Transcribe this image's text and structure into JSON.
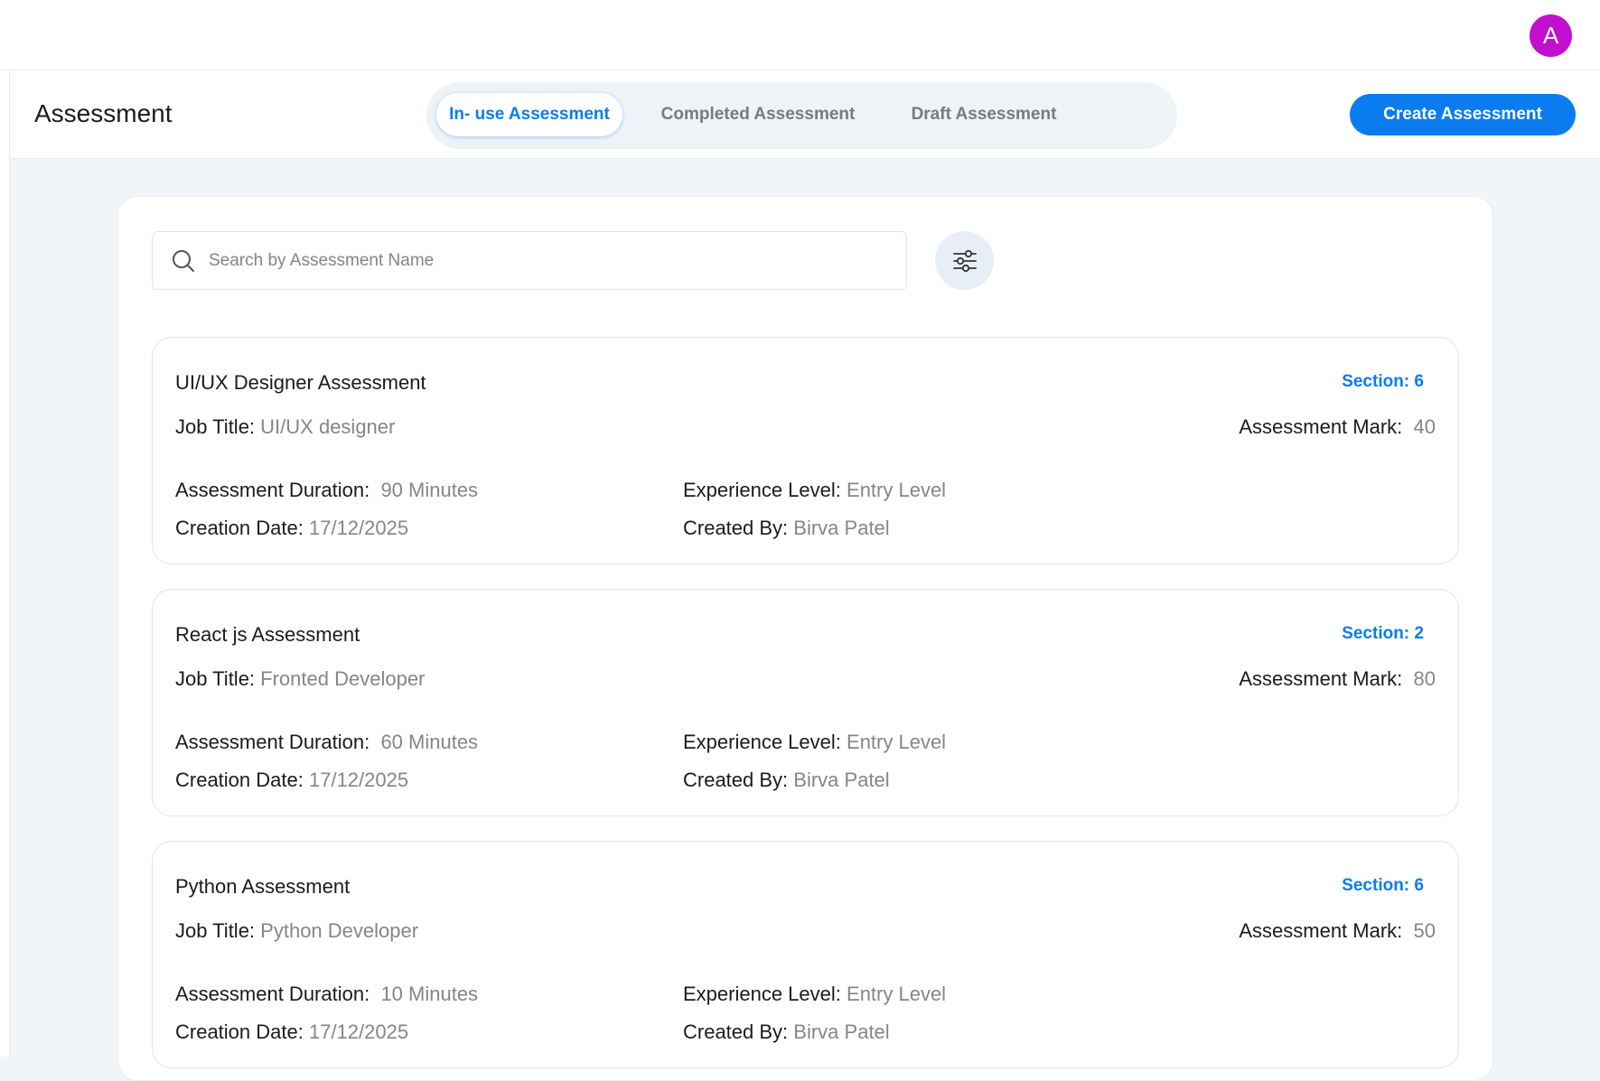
{
  "user": {
    "avatar_initial": "A",
    "avatar_color": "#c20fcf"
  },
  "header": {
    "title": "Assessment",
    "tabs": [
      {
        "label": "In- use Assessment",
        "active": true
      },
      {
        "label": "Completed Assessment",
        "active": false
      },
      {
        "label": "Draft Assessment",
        "active": false
      }
    ],
    "create_label": "Create Assessment"
  },
  "search": {
    "placeholder": "Search by Assessment Name",
    "value": ""
  },
  "labels": {
    "job_title": "Job Title:",
    "mark": "Assessment Mark:",
    "duration": "Assessment Duration:",
    "experience": "Experience Level:",
    "creation_date": "Creation Date:",
    "created_by": "Created By:"
  },
  "assessments": [
    {
      "name": "UI/UX Designer Assessment",
      "section": "Section: 6",
      "job_title": "UI/UX designer",
      "mark": "40",
      "duration": "90 Minutes",
      "experience": "Entry Level",
      "creation_date": "17/12/2025",
      "created_by": "Birva Patel"
    },
    {
      "name": "React js Assessment",
      "section": "Section: 2",
      "job_title": "Fronted Developer",
      "mark": "80",
      "duration": "60 Minutes",
      "experience": "Entry Level",
      "creation_date": "17/12/2025",
      "created_by": "Birva Patel"
    },
    {
      "name": "Python Assessment",
      "section": "Section: 6",
      "job_title": "Python Developer",
      "mark": "50",
      "duration": "10 Minutes",
      "experience": "Entry Level",
      "creation_date": "17/12/2025",
      "created_by": "Birva Patel"
    }
  ],
  "colors": {
    "accent": "#0a7cf0",
    "muted_text": "#868686",
    "background": "#f1f5f8"
  }
}
